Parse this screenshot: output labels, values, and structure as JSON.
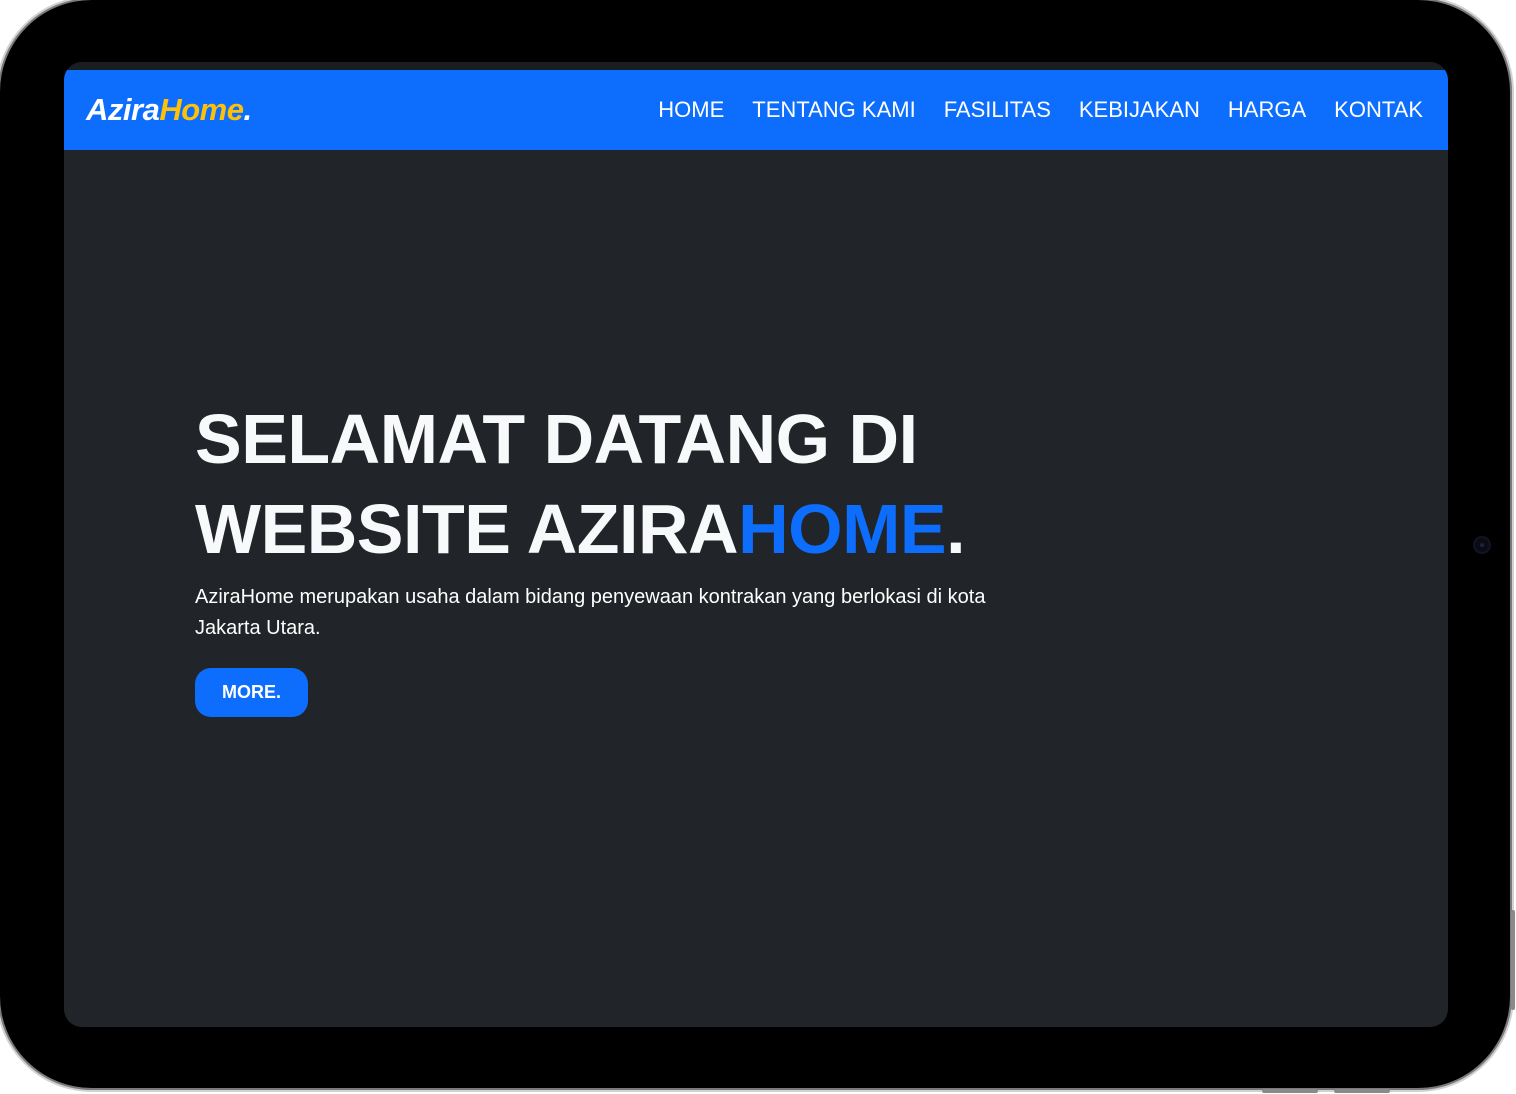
{
  "brand": {
    "part1": "Azira",
    "part2": "Home",
    "part3": "."
  },
  "nav": {
    "items": [
      {
        "label": "HOME"
      },
      {
        "label": "TENTANG KAMI"
      },
      {
        "label": "FASILITAS"
      },
      {
        "label": "KEBIJAKAN"
      },
      {
        "label": "HARGA"
      },
      {
        "label": "KONTAK"
      }
    ]
  },
  "hero": {
    "title_line1": "SELAMAT DATANG DI",
    "title_line2_prefix": "WEBSITE AZIRA",
    "title_line2_accent": "HOME",
    "title_line2_suffix": ".",
    "description": "AziraHome merupakan usaha dalam bidang penyewaan kontrakan yang berlokasi di kota Jakarta Utara.",
    "button_label": "MORE."
  },
  "colors": {
    "navbar": "#0d6efd",
    "background": "#212529",
    "brand_accent": "#ffc107",
    "title_accent": "#0d6efd",
    "button": "#0d6efd"
  }
}
